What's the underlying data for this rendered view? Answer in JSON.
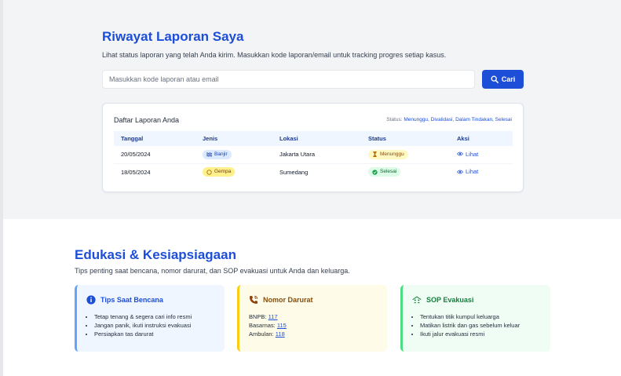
{
  "history": {
    "title": "Riwayat Laporan Saya",
    "subtitle": "Lihat status laporan yang telah Anda kirim. Masukkan kode laporan/email untuk tracking progres setiap kasus.",
    "search_placeholder": "Masukkan kode laporan atau email",
    "search_button": "Cari",
    "card_title": "Daftar Laporan Anda",
    "status_legend_label": "Status:",
    "status_legend_values": "Menunggu, Divalidasi, Dalam Tindakan, Selesai",
    "columns": [
      "Tanggal",
      "Jenis",
      "Lokasi",
      "Status",
      "Aksi"
    ],
    "rows": [
      {
        "date": "20/05/2024",
        "type": "Banjir",
        "location": "Jakarta Utara",
        "status": "Menunggu",
        "action": "Lihat"
      },
      {
        "date": "18/05/2024",
        "type": "Gempa",
        "location": "Sumedang",
        "status": "Selesai",
        "action": "Lihat"
      }
    ]
  },
  "edu": {
    "title": "Edukasi & Kesiapsiagaan",
    "subtitle": "Tips penting saat bencana, nomor darurat, dan SOP evakuasi untuk Anda dan keluarga.",
    "tips": {
      "title": "Tips Saat Bencana",
      "items": [
        "Tetap tenang & segera cari info resmi",
        "Jangan panik, ikuti instruksi evakuasi",
        "Persiapkan tas darurat"
      ]
    },
    "phones": {
      "title": "Nomor Darurat",
      "items": [
        {
          "label": "BNPB:",
          "number": "117"
        },
        {
          "label": "Basarnas:",
          "number": "115"
        },
        {
          "label": "Ambulan:",
          "number": "118"
        }
      ]
    },
    "sop": {
      "title": "SOP Evakuasi",
      "items": [
        "Tentukan titik kumpul keluarga",
        "Matikan listrik dan gas sebelum keluar",
        "Ikuti jalur evakuasi resmi"
      ]
    }
  },
  "colors": {
    "accent": "#1d4ed8",
    "section_bg": "#f3f4f6"
  },
  "icons": {
    "search": "search-icon",
    "flood": "waves-icon",
    "quake": "circle-icon",
    "pending": "hourglass-icon",
    "done": "check-circle-icon",
    "view": "eye-icon",
    "tips": "info-icon",
    "phone": "phone-icon",
    "sop": "house-people-icon"
  }
}
